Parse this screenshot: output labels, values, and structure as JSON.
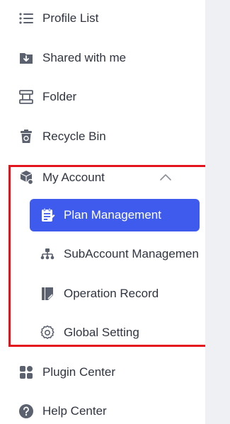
{
  "nav": {
    "profile_list": {
      "label": "Profile List",
      "icon": "list-icon"
    },
    "shared_with_me": {
      "label": "Shared with me",
      "icon": "shared-download-icon"
    },
    "folder": {
      "label": "Folder",
      "icon": "folder-icon"
    },
    "recycle_bin": {
      "label": "Recycle Bin",
      "icon": "recycle-bin-icon"
    },
    "my_account": {
      "label": "My Account",
      "icon": "account-cubes-icon",
      "expanded": true
    },
    "plugin_center": {
      "label": "Plugin Center",
      "icon": "plugin-grid-icon"
    },
    "help_center": {
      "label": "Help Center",
      "icon": "help-icon"
    }
  },
  "account_menu": {
    "plan_management": {
      "label": "Plan Management",
      "icon": "plan-clipboard-icon",
      "active": true
    },
    "subaccount_management": {
      "label": "SubAccount Managemen",
      "icon": "org-tree-icon"
    },
    "operation_record": {
      "label": "Operation Record",
      "icon": "record-note-icon"
    },
    "global_setting": {
      "label": "Global Setting",
      "icon": "gear-icon"
    }
  },
  "colors": {
    "accent": "#3f5bee",
    "highlight_border": "#e3141b",
    "text": "#2f3440",
    "icon": "#5b616e",
    "side_panel": "#eef0f4"
  }
}
